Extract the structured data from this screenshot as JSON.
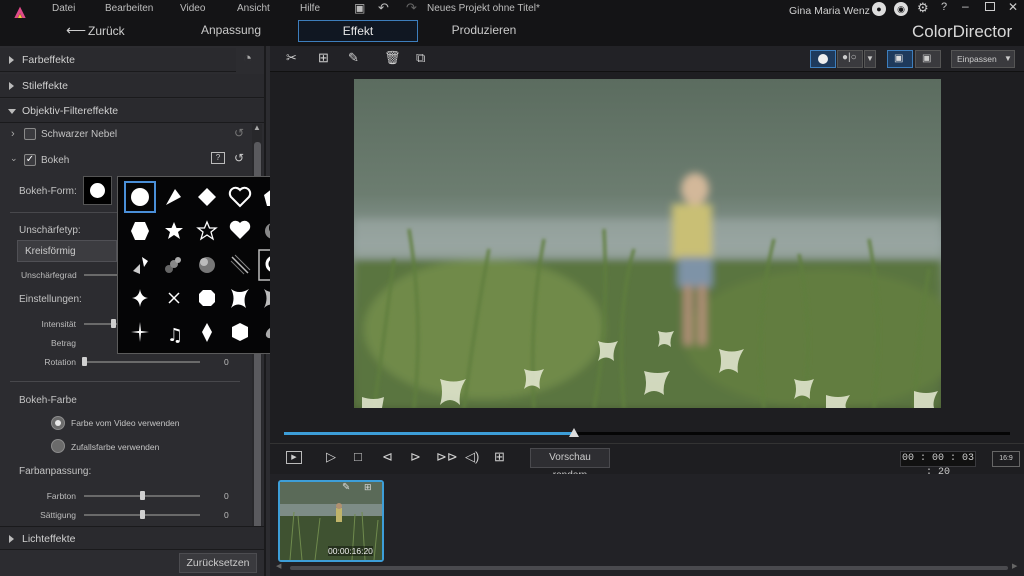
{
  "app": {
    "title": "ColorDirector",
    "user": "Gina Maria Wenz",
    "project": "Neues Projekt ohne Titel*"
  },
  "menu": [
    "Datei",
    "Bearbeiten",
    "Video",
    "Ansicht",
    "Hilfe"
  ],
  "nav": {
    "back": "Zurück",
    "tabs": [
      "Anpassung",
      "Effekt",
      "Produzieren"
    ]
  },
  "panel": {
    "sections": {
      "farbeffekte": "Farbeffekte",
      "stileffekte": "Stileffekte",
      "objektiv": "Objektiv-Filtereffekte",
      "lichteffekte": "Lichteffekte"
    },
    "schwarzer_nebel": "Schwarzer Nebel",
    "bokeh": "Bokeh",
    "bokeh_form": "Bokeh-Form:",
    "unschaerfetyp": "Unschärfetyp:",
    "unschaerfetyp_value": "Kreisförmig",
    "unschaerfegrad": "Unschärfegrad",
    "einstellungen": "Einstellungen:",
    "intensitaet": "Intensität",
    "betrag": "Betrag",
    "rotation": "Rotation",
    "rotation_value": "0",
    "bokeh_farbe": "Bokeh-Farbe",
    "radio1": "Farbe vom Video verwenden",
    "radio2": "Zufallsfarbe verwenden",
    "farbanpassung": "Farbanpassung:",
    "farbton": "Farbton",
    "farbton_value": "0",
    "saettigung": "Sättigung",
    "saettigung_value": "0",
    "reset": "Zurücksetzen",
    "sliders": {
      "rotation": 0.0,
      "farbton": 0.5,
      "saettigung": 0.5,
      "intensitaet": 0.3
    }
  },
  "toolbar": {
    "fit": "Einpassen"
  },
  "player": {
    "render": "Vorschau rendern",
    "time": "00 : 00 : 03 : 20",
    "ratio": "16:9",
    "progress": 0.4
  },
  "clip": {
    "duration": "00:00:16:20"
  }
}
